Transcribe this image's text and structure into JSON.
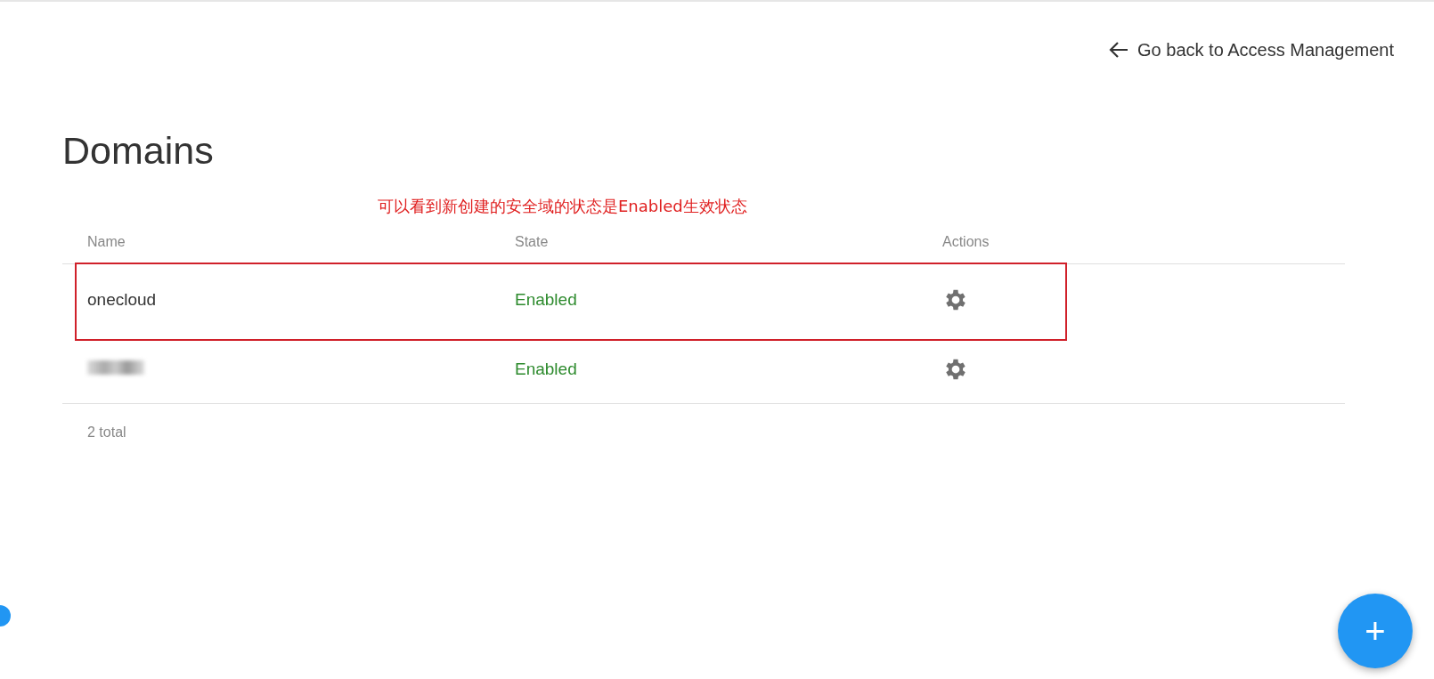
{
  "back_link": {
    "label": "Go back to Access Management"
  },
  "title": "Domains",
  "annotation": {
    "text": "可以看到新创建的安全域的状态是Enabled生效状态"
  },
  "table": {
    "columns": [
      "Name",
      "State",
      "Actions"
    ],
    "rows": [
      {
        "name": "onecloud",
        "redacted": false,
        "highlighted": true,
        "state": "Enabled"
      },
      {
        "redacted": true,
        "highlighted": false,
        "state": "Enabled"
      }
    ],
    "footer": "2 total"
  },
  "fab": {
    "label": "+"
  }
}
